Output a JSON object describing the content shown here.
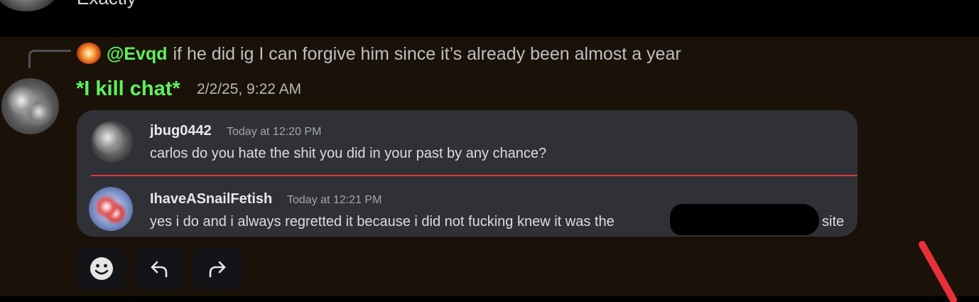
{
  "previous_message": {
    "text": "Exactly"
  },
  "reply": {
    "author": "@Evqd",
    "text": "if he did ig I can forgive him since it’s already been almost a year"
  },
  "message": {
    "author": "*I kill chat*",
    "timestamp": "2/2/25, 9:22 AM"
  },
  "embed": {
    "question": {
      "author": "jbug0442",
      "time": "Today at 12:20 PM",
      "text": "carlos do you hate the shit you did in your past by any chance?"
    },
    "answer": {
      "author": "IhaveASnailFetish",
      "time": "Today at 12:21 PM",
      "text_before": "yes i do and i always regretted it because i did not fucking knew it was the",
      "text_after": "site"
    }
  },
  "actions": {
    "add_reaction_icon": "smile-face-icon",
    "reply_icon": "reply-arrow-icon",
    "forward_icon": "forward-arrow-icon"
  },
  "colors": {
    "username_green": "#5ef25e",
    "embed_bg": "#2f3136",
    "divider_red": "#e03a3a",
    "annotation_red": "#e8303a"
  }
}
